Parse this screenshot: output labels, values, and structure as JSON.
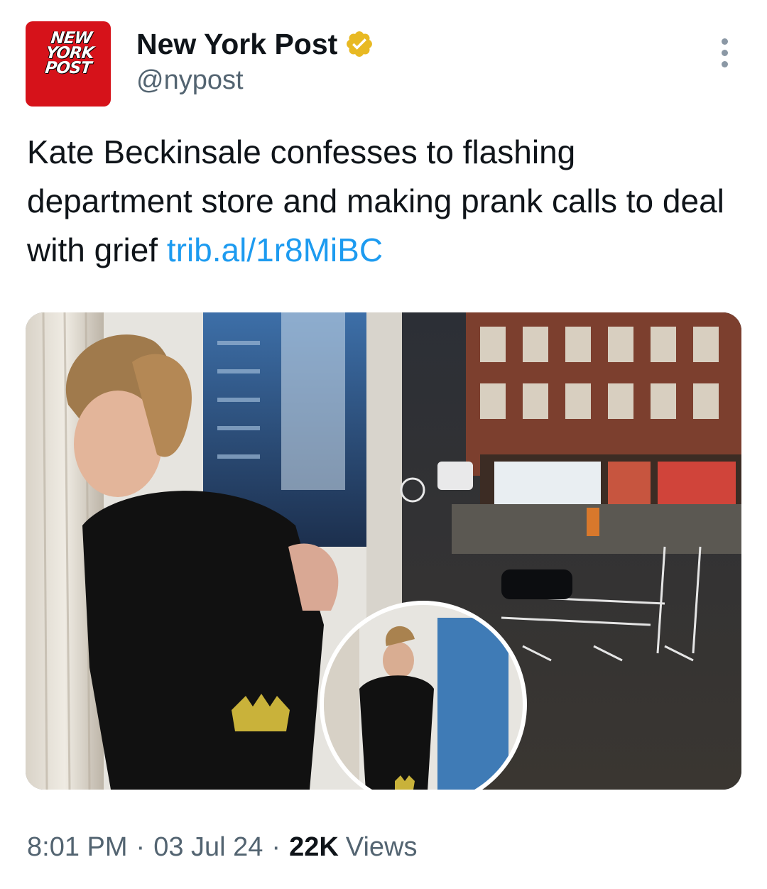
{
  "account": {
    "avatar_logo": "NEW YORK POST",
    "display_name": "New York Post",
    "handle": "@nypost",
    "verified": true,
    "verified_color": "#e8b923"
  },
  "tweet": {
    "text": "Kate Beckinsale confesses to flashing department store and making prank calls to deal with grief",
    "link": "trib.al/1r8MiBC",
    "link_color": "#1d9bf0",
    "time": "8:01 PM",
    "date": "03 Jul 24",
    "views_count": "22K",
    "views_label": "Views"
  },
  "icons": {
    "verified": "verified-badge-icon",
    "more": "more-options-icon"
  }
}
